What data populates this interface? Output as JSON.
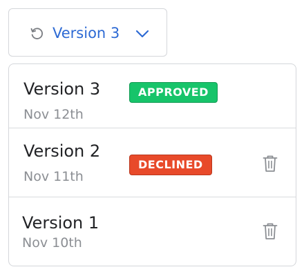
{
  "trigger": {
    "label": "Version 3",
    "icon": "history-icon",
    "chevron": "chevron-down-icon",
    "accent_color": "#2d6ad4"
  },
  "versions": [
    {
      "name": "Version 3",
      "date": "Nov 12th",
      "status": "APPROVED",
      "status_color": "#17c46a",
      "deletable": false
    },
    {
      "name": "Version 2",
      "date": "Nov 11th",
      "status": "DECLINED",
      "status_color": "#e84a2a",
      "deletable": true,
      "delete_icon": "trash-icon"
    },
    {
      "name": "Version 1",
      "date": "Nov 10th",
      "status": "",
      "deletable": true,
      "delete_icon": "trash-icon"
    }
  ]
}
